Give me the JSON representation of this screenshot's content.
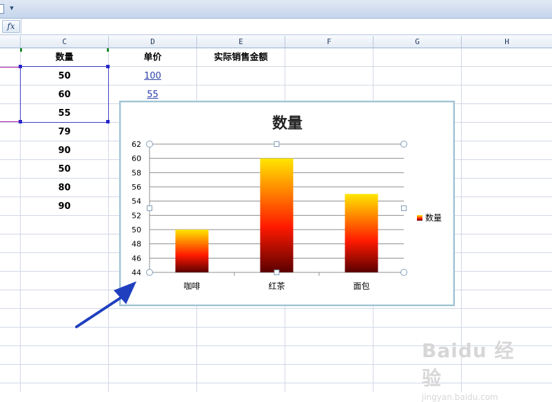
{
  "formula_bar": {
    "fx_label": "fx",
    "value": ""
  },
  "columns": [
    "C",
    "D",
    "E",
    "F",
    "G",
    "H"
  ],
  "sheet": {
    "col_c_header": "数量",
    "col_d_header": "单价",
    "col_e_header": "实际销售金额",
    "quantity_values": [
      "50",
      "60",
      "55",
      "79",
      "90",
      "50",
      "80",
      "90"
    ],
    "price_values": [
      "100",
      "55"
    ]
  },
  "chart_data": {
    "type": "bar",
    "title": "数量",
    "categories": [
      "咖啡",
      "红茶",
      "面包"
    ],
    "series": [
      {
        "name": "数量",
        "values": [
          50,
          60,
          55
        ]
      }
    ],
    "ylim": [
      44,
      62
    ],
    "yticks": [
      44,
      46,
      48,
      50,
      52,
      54,
      56,
      58,
      60,
      62
    ],
    "grid": true,
    "legend": "right",
    "fill": {
      "top": "#ffe600",
      "middle": "#ff1a00",
      "bottom": "#5a0000"
    }
  },
  "annotation": {
    "arrow_color": "#1f3fbf"
  },
  "watermark": {
    "brand": "Baidu 经验",
    "url": "jingyan.baidu.com"
  }
}
